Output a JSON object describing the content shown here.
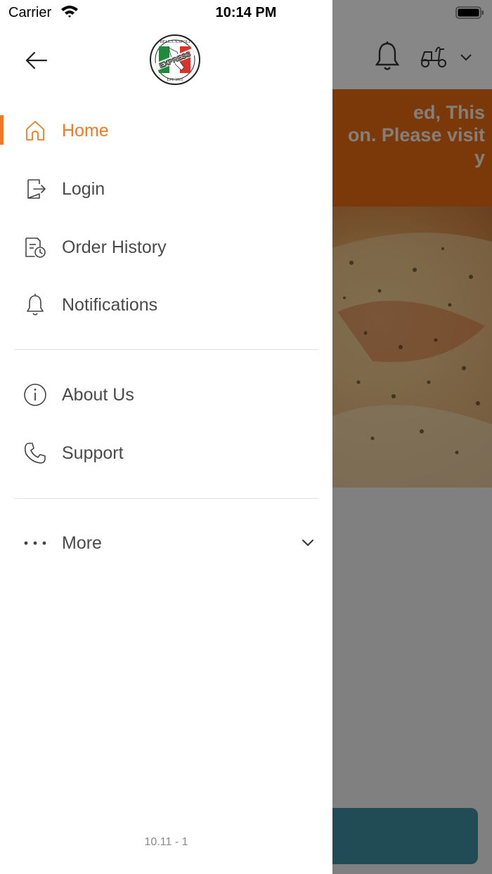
{
  "status_bar": {
    "carrier": "Carrier",
    "time": "10:14 PM"
  },
  "background": {
    "banner_text": "ed, This\non. Please visit\ny",
    "colors": {
      "banner": "#e86a10",
      "bottom_button": "#3f8ea0"
    }
  },
  "logo": {
    "text_top": "BELLA NAPOLI",
    "text_mid": "EXPRESS",
    "text_bottom": "EST. 2003"
  },
  "menu": {
    "accent_color": "#f07a23",
    "items": [
      {
        "label": "Home",
        "icon": "home-icon",
        "active": true
      },
      {
        "label": "Login",
        "icon": "login-icon"
      },
      {
        "label": "Order History",
        "icon": "order-history-icon"
      },
      {
        "label": "Notifications",
        "icon": "bell-icon"
      },
      {
        "label": "About Us",
        "icon": "info-icon"
      },
      {
        "label": "Support",
        "icon": "phone-icon"
      },
      {
        "label": "More",
        "icon": "more-dots-icon"
      }
    ]
  },
  "app_version": "10.11 - 1"
}
